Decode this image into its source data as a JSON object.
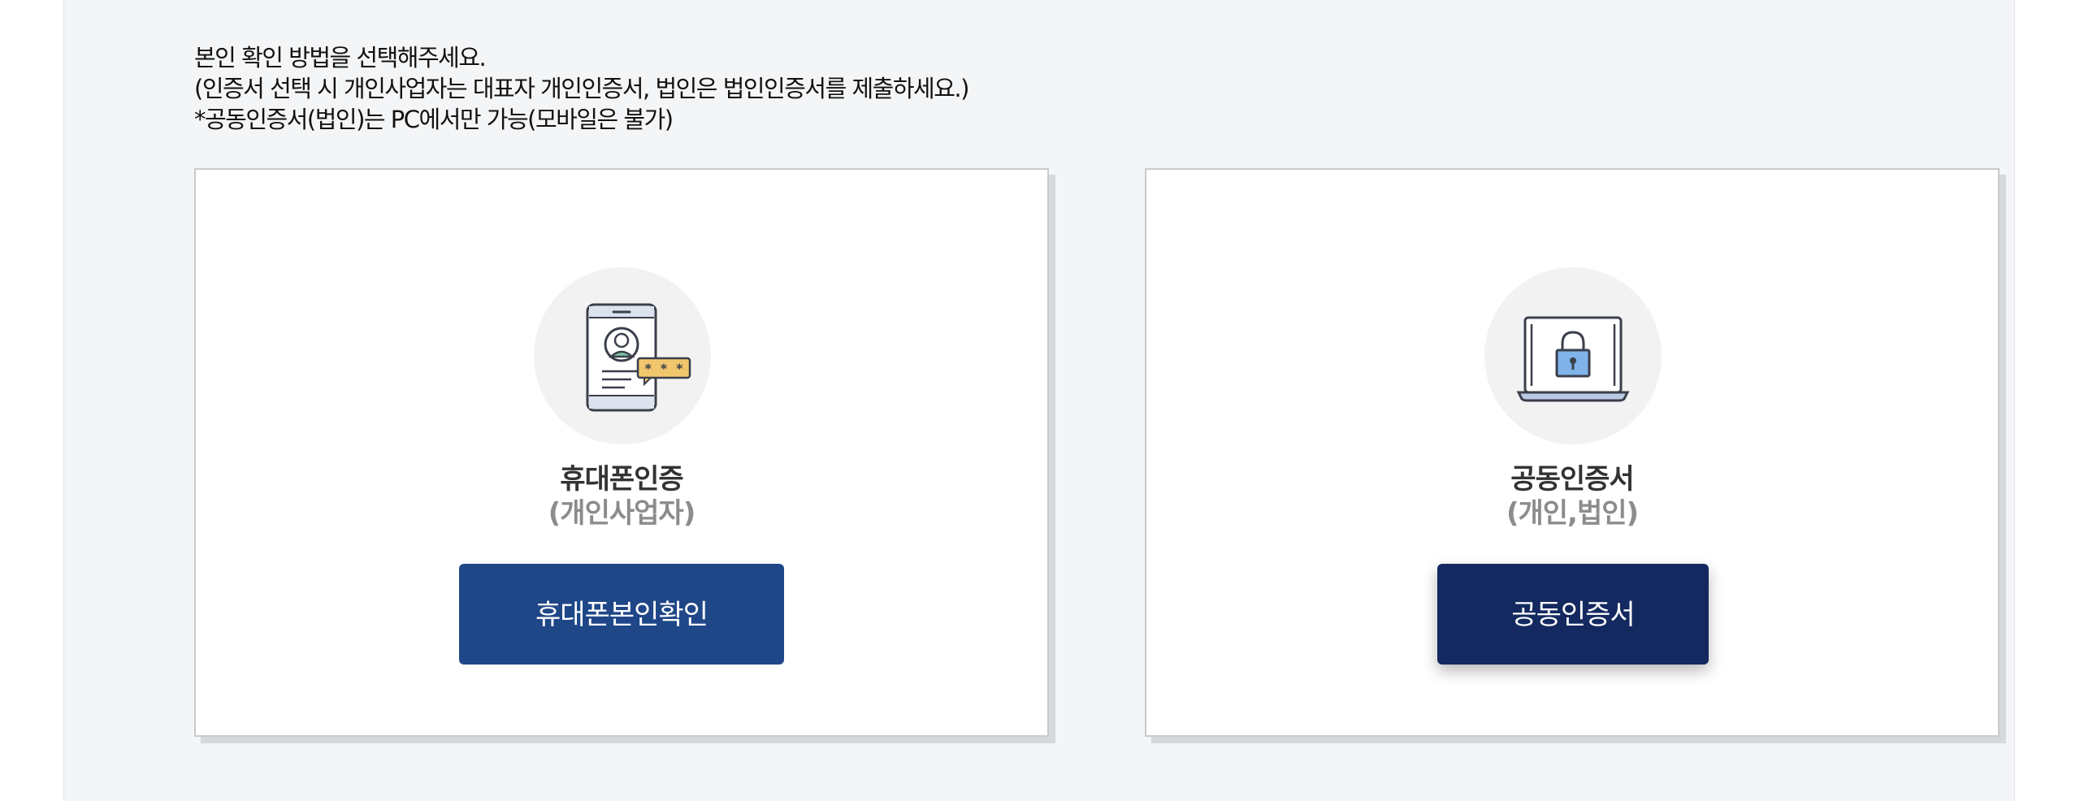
{
  "instructions": {
    "line1": "본인 확인 방법을 선택해주세요.",
    "line2": "(인증서 선택 시 개인사업자는 대표자 개인인증서, 법인은 법인인증서를 제출하세요.)",
    "line3": "*공동인증서(법인)는 PC에서만 가능(모바일은 불가)"
  },
  "cards": [
    {
      "icon": "smartphone-auth-icon",
      "title": "휴대폰인증",
      "subtitle": "(개인사업자)",
      "button_label": "휴대폰본인확인",
      "button_color": "#1f4788"
    },
    {
      "icon": "laptop-lock-icon",
      "title": "공동인증서",
      "subtitle": "(개인,법인)",
      "button_label": "공동인증서",
      "button_color": "#13295f"
    }
  ],
  "colors": {
    "panel_bg": "#f4f5f7",
    "card_bg": "#ffffff",
    "card_border": "#c9cacd",
    "icon_circle": "#f2f2f3",
    "title_text": "#333333",
    "subtitle_text": "#8c8c8c"
  }
}
